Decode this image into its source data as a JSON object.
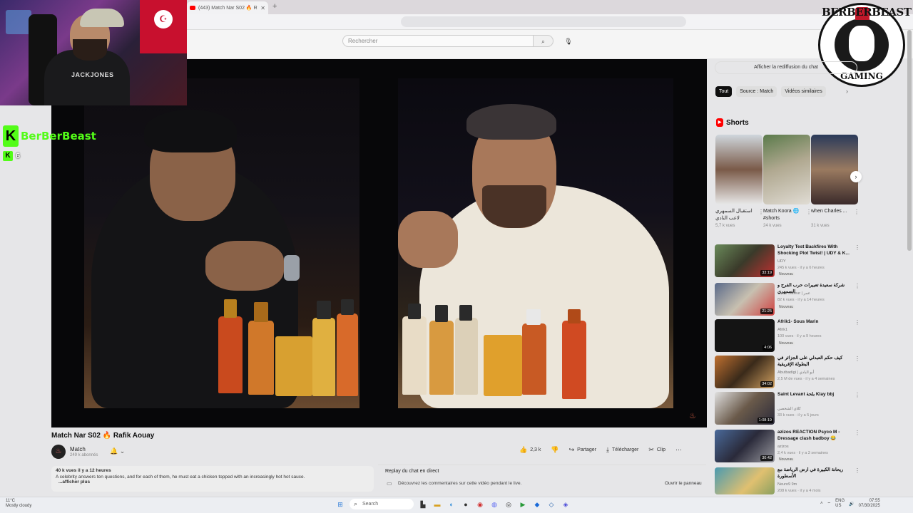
{
  "browser": {
    "tab_title": "(443) Match Nar S02 🔥 R",
    "tab_close": "✕",
    "new_tab": "+"
  },
  "masthead": {
    "search_placeholder": "Rechercher",
    "search_icon": "search-icon",
    "mic_icon": "mic-icon"
  },
  "overlay": {
    "kick_logo": "K",
    "kick_name": "BerBerBeast",
    "viewer_logo": "K",
    "viewer_count": "6",
    "brand_top": "BERBERBEAST",
    "brand_bottom": "GAMING",
    "shirt_text": "JACKJONES"
  },
  "video": {
    "title": "Match Nar S02 🔥 Rafik Aouay",
    "channel": "Match",
    "subscribers": "249 k abonnés",
    "actions": {
      "likes": "2,3 k",
      "share": "Partager",
      "download": "Télécharger",
      "clip": "Clip"
    },
    "description": {
      "stats": "40 k vues  il y a 12 heures",
      "text": "A celebrity answers ten questions, and for each of them, he must eat a chicken topped with an increasingly hot hot sauce.",
      "more": "...afficher plus"
    },
    "chat_replay": {
      "title": "Replay du chat en direct",
      "text": "Découvrez les commentaires sur cette vidéo pendant le live.",
      "button": "Ouvrir le panneau"
    }
  },
  "sidebar": {
    "chat_toggle": "Afficher la rediffusion du chat",
    "chips": [
      "Tout",
      "Source : Match",
      "Vidéos similaires"
    ],
    "shorts_label": "Shorts",
    "shorts": [
      {
        "title": "استقبال السمهري لاعب النادي",
        "views": "5,7 k vues"
      },
      {
        "title": "Match Koora 🌐 #shorts",
        "views": "24 k vues"
      },
      {
        "title": "when Charles ...",
        "views": "31 k vues"
      }
    ],
    "recommended": [
      {
        "title": "Loyalty Test Backfires With Shocking Plot Twist! | UDY & K...",
        "channel": "UDY",
        "meta": "245 k vues · il y a 6 heures",
        "badge": "Nouveau",
        "duration": "33:19"
      },
      {
        "title": "شركة سعيدة تعبيرات حرب الفرح و السمهري",
        "channel": "Omar Jabeur | عمر",
        "meta": "82 k vues · il y a 14 heures",
        "badge": "Nouveau",
        "duration": "21:25"
      },
      {
        "title": "Afrik1- Sous Marin",
        "channel": "Afrik1",
        "meta": "100 vues · il y a 9 heures",
        "badge": "Nouveau",
        "duration": "4:06"
      },
      {
        "title": "كيف حكم العبدلي على الجزائر في البطولة الإفريقية",
        "channel": "Abutbadigi | أبو البادي",
        "meta": "2,5 M de vues · il y a 4 semaines",
        "badge": "",
        "duration": "34:02"
      },
      {
        "title": "Saint Levant بلحة Klay bbj",
        "channel": "كلاي الشخصي",
        "meta": "33 k vues · il y a 5 jours",
        "badge": "",
        "duration": "1:08:19"
      },
      {
        "title": "azizos REACTION Psyco M - Dressage clash badboy 😂",
        "channel": "azizos",
        "meta": "2,4 k vues · il y a 3 semaines",
        "badge": "Nouveau",
        "duration": "30:42"
      },
      {
        "title": "ريحانة الكبيرة في أرض الرياضة مع الأسطورة",
        "channel": "Neuro9 9m",
        "meta": "208 k vues · il y a 4 mois",
        "badge": "",
        "duration": ""
      }
    ]
  },
  "taskbar": {
    "weather_temp": "11°C",
    "weather_desc": "Mostly cloudy",
    "search_label": "Search",
    "lang": "ENG",
    "lang2": "US",
    "time": "07:55",
    "date": "07/30/2025"
  }
}
